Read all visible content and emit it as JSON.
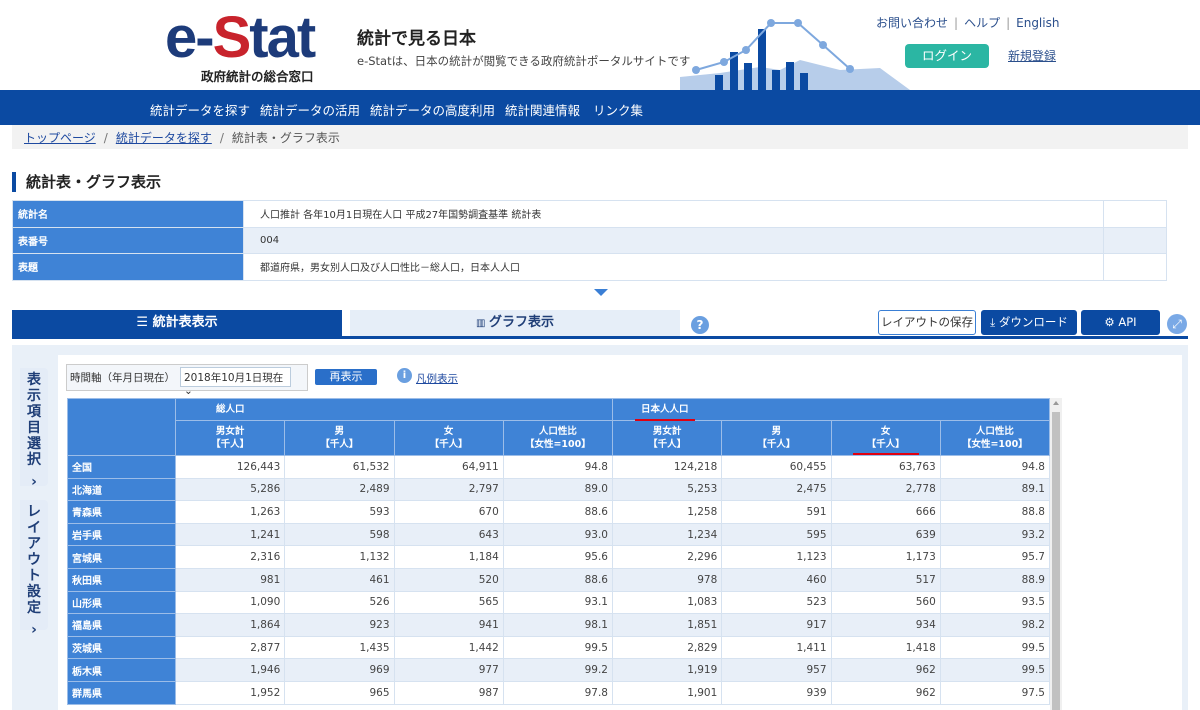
{
  "header": {
    "logo_text": "e-Stat",
    "logo_sub": "政府統計の総合窓口",
    "title": "統計で見る日本",
    "subtitle": "e-Statは、日本の統計が閲覧できる政府統計ポータルサイトです",
    "links": [
      "お問い合わせ",
      "ヘルプ",
      "English"
    ],
    "login": "ログイン",
    "register": "新規登録"
  },
  "nav": [
    "統計データを探す",
    "統計データの活用",
    "統計データの高度利用",
    "統計関連情報",
    "リンク集"
  ],
  "breadcrumb": {
    "items": [
      "トップページ",
      "統計データを探す"
    ],
    "current": "統計表・グラフ表示"
  },
  "page_title": "統計表・グラフ表示",
  "info": [
    {
      "label": "統計名",
      "value": "人口推計 各年10月1日現在人口 平成27年国勢調査基準 統計表"
    },
    {
      "label": "表番号",
      "value": "004"
    },
    {
      "label": "表題",
      "value": "都道府県，男女別人口及び人口性比－総人口，日本人人口"
    }
  ],
  "tabs": {
    "table": "統計表表示",
    "graph": "グラフ表示"
  },
  "buttons": {
    "save_layout": "レイアウトの保存",
    "download": "ダウンロード",
    "api": "API"
  },
  "side_tabs": [
    "表示項目選択",
    "レイアウト設定"
  ],
  "controls": {
    "time_label": "時間軸（年月日現在）",
    "time_value": "2018年10月1日現在",
    "redisplay": "再表示",
    "legend": "凡例表示"
  },
  "table": {
    "groups": [
      "総人口",
      "日本人人口"
    ],
    "columns": [
      {
        "name": "男女計",
        "unit": "【千人】"
      },
      {
        "name": "男",
        "unit": "【千人】"
      },
      {
        "name": "女",
        "unit": "【千人】"
      },
      {
        "name": "人口性比",
        "unit": "【女性=100】"
      }
    ],
    "rows": [
      [
        "全国",
        "126,443",
        "61,532",
        "64,911",
        "94.8",
        "124,218",
        "60,455",
        "63,763",
        "94.8"
      ],
      [
        "北海道",
        "5,286",
        "2,489",
        "2,797",
        "89.0",
        "5,253",
        "2,475",
        "2,778",
        "89.1"
      ],
      [
        "青森県",
        "1,263",
        "593",
        "670",
        "88.6",
        "1,258",
        "591",
        "666",
        "88.8"
      ],
      [
        "岩手県",
        "1,241",
        "598",
        "643",
        "93.0",
        "1,234",
        "595",
        "639",
        "93.2"
      ],
      [
        "宮城県",
        "2,316",
        "1,132",
        "1,184",
        "95.6",
        "2,296",
        "1,123",
        "1,173",
        "95.7"
      ],
      [
        "秋田県",
        "981",
        "461",
        "520",
        "88.6",
        "978",
        "460",
        "517",
        "88.9"
      ],
      [
        "山形県",
        "1,090",
        "526",
        "565",
        "93.1",
        "1,083",
        "523",
        "560",
        "93.5"
      ],
      [
        "福島県",
        "1,864",
        "923",
        "941",
        "98.1",
        "1,851",
        "917",
        "934",
        "98.2"
      ],
      [
        "茨城県",
        "2,877",
        "1,435",
        "1,442",
        "99.5",
        "2,829",
        "1,411",
        "1,418",
        "99.5"
      ],
      [
        "栃木県",
        "1,946",
        "969",
        "977",
        "99.2",
        "1,919",
        "957",
        "962",
        "99.5"
      ],
      [
        "群馬県",
        "1,952",
        "965",
        "987",
        "97.8",
        "1,901",
        "939",
        "962",
        "97.5"
      ]
    ]
  },
  "colors": {
    "primary": "#0b4aa2",
    "header_cell": "#3f83d6",
    "login": "#2bb6a3",
    "logo_red": "#c8232c",
    "highlight": "#e00010"
  }
}
